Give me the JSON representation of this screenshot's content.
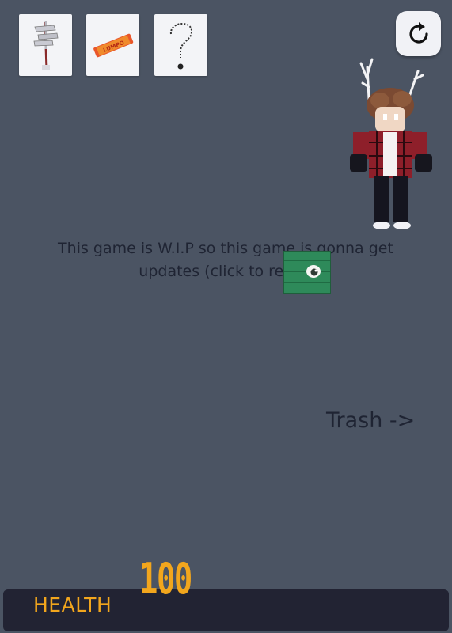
{
  "inventory": {
    "items": [
      {
        "icon": "signpost-icon"
      },
      {
        "icon": "candy-bar-icon",
        "wrapper_text": "LUMPO"
      },
      {
        "icon": "question-mark-icon"
      }
    ]
  },
  "reset_button": {
    "icon": "restart-icon"
  },
  "character": {
    "icon": "deer-antler-avatar-icon"
  },
  "notice": {
    "text": "This game is W.I.P so this game is gonna get updates (click to reset)"
  },
  "crate": {
    "icon": "green-crate-eye-icon"
  },
  "trash": {
    "label": "Trash ->"
  },
  "health": {
    "label": "HEALTH",
    "value": "100",
    "color": "#f2a61d"
  },
  "colors": {
    "background": "#4b5463",
    "health_bar": "#222333",
    "crate": "#2e8a5a"
  }
}
